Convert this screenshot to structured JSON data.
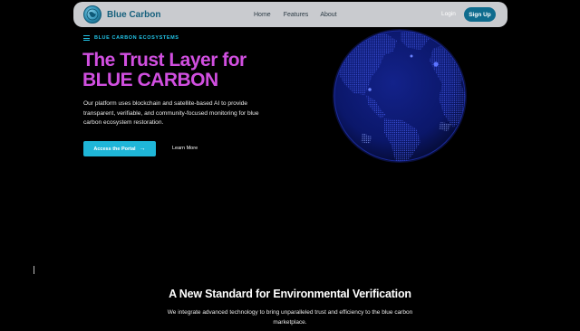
{
  "navbar": {
    "brand": "Blue Carbon",
    "links": [
      "Home",
      "Features",
      "About"
    ],
    "login": "Login",
    "signup": "Sign Up"
  },
  "hero": {
    "eyebrow": "BLUE CARBON ECOSYSTEMS",
    "title_line1": "The Trust Layer for",
    "title_line2": "BLUE CARBON",
    "description": "Our platform uses blockchain and satellite-based AI to provide transparent, verifiable, and community-focused monitoring for blue carbon ecosystem restoration.",
    "primary_cta": "Access the Portal",
    "secondary_cta": "Learn More"
  },
  "section": {
    "title": "A New Standard for Environmental Verification",
    "description": "We integrate advanced technology to bring unparalleled trust and efficiency to the blue carbon marketplace."
  },
  "colors": {
    "accent_cyan": "#22c3e6",
    "title_magenta": "#d14fe0",
    "brand_teal": "#145f7c",
    "globe_ocean": "#0c1a6e"
  },
  "icons": {
    "logo": "globe-logo-icon",
    "eyebrow": "menu-lines-icon",
    "cta_arrow": "arrow-right-icon"
  }
}
